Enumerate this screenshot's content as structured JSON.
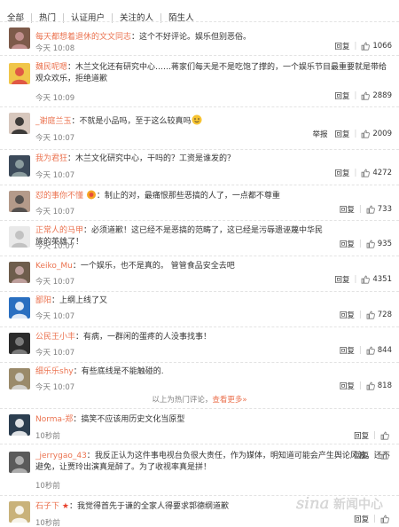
{
  "filters": [
    "全部",
    "热门",
    "认证用户",
    "关注的人",
    "陌生人"
  ],
  "actions": {
    "reply": "回复",
    "report": "举报"
  },
  "hot_comments": [
    {
      "name": "每天都想着退休的文文同志",
      "text": "这个不好评论。娱乐但别恶俗。",
      "time": "今天 10:08",
      "likes": "1066",
      "avatar": {
        "bg": "#7d5a4a",
        "fg": "#c99"
      }
    },
    {
      "name": "魏民呢嗯",
      "text": "木兰文化还有研究中心……蒋家们每天是不是吃饱了撑的，一个娱乐节目最重要就是带给观众欢乐，拒绝道歉",
      "time": "今天 10:09",
      "likes": "2889",
      "avatar": {
        "bg": "#f0c64a",
        "fg": "#d44"
      }
    },
    {
      "name": "_谢庭兰玉",
      "text": "不就是小品吗，至于这么较真吗",
      "time": "今天 10:07",
      "likes": "2009",
      "emoji": true,
      "report": true,
      "avatar": {
        "bg": "#d7c7bd",
        "fg": "#222"
      }
    },
    {
      "name": "我为君狂",
      "text": "木兰文化研究中心，干吗的？工资是谁发的？",
      "time": "今天 10:07",
      "likes": "4272",
      "avatar": {
        "bg": "#3c4a5a",
        "fg": "#9aa"
      }
    },
    {
      "name": "怼的事你不懂",
      "text": "制止的对，最痛恨那些恶搞的人了，一点都不尊重",
      "time": "今天 10:07",
      "likes": "733",
      "badge": true,
      "avatar": {
        "bg": "#b49a8a",
        "fg": "#444"
      }
    },
    {
      "name": "正常人的马甲",
      "text": "必须道歉！这已经不是恶搞的范畴了，这已经是污辱遗诬蔑中华民族的英雄了！",
      "time": "今天 10:07",
      "likes": "935",
      "avatar": {
        "bg": "#e9e9e9",
        "fg": "#bbb"
      }
    },
    {
      "name": "Keiko_Mu",
      "text": "一个娱乐，也不是真的。 管管食品安全去吧",
      "time": "今天 10:07",
      "likes": "4351",
      "avatar": {
        "bg": "#6e5d4c",
        "fg": "#caa"
      }
    },
    {
      "name": "鄙阳",
      "text": "上纲上线了又",
      "time": "今天 10:07",
      "likes": "728",
      "avatar": {
        "bg": "#2a6fc0",
        "fg": "#fff"
      }
    },
    {
      "name": "公民王小丰",
      "text": "有病，一群闲的蛋疼的人没事找事！",
      "time": "今天 10:07",
      "likes": "844",
      "avatar": {
        "bg": "#2b2b2b",
        "fg": "#888"
      }
    },
    {
      "name": "细乐乐shy",
      "text": "有些底线是不能触碰的.",
      "time": "今天 10:07",
      "likes": "818",
      "avatar": {
        "bg": "#9a8a6a",
        "fg": "#ddd"
      }
    }
  ],
  "hot_note": {
    "prefix": "以上为热门评论，",
    "more": "查看更多»"
  },
  "recent_comments": [
    {
      "name": "Norma-郑",
      "text": "搞笑不应该用历史文化当原型",
      "time": "10秒前",
      "likes": "",
      "avatar": {
        "bg": "#2c3e50",
        "fg": "#fff"
      }
    },
    {
      "name": "_jerrygao_43",
      "text": "我反正认为这件事电视台负很大责任，作为媒体，明知道可能会产生舆论风波，还不避免，让贾玲出演真是醉了。为了收视率真是拼！",
      "time": "10秒前",
      "likes": "",
      "avatar": {
        "bg": "#5a5a5a",
        "fg": "#bbb"
      }
    },
    {
      "name": "石子下",
      "text": "我觉得首先于谦的全家人得要求郭德纲道歉",
      "time": "10秒前",
      "likes": "",
      "star": true,
      "avatar": {
        "bg": "#c9b27a",
        "fg": "#fff"
      }
    }
  ],
  "watermark": {
    "brand": "sina",
    "text": "新闻中心"
  },
  "colors": {
    "name": "#eb7350",
    "text": "#333333",
    "time": "#808080",
    "link": "#eb7350"
  }
}
